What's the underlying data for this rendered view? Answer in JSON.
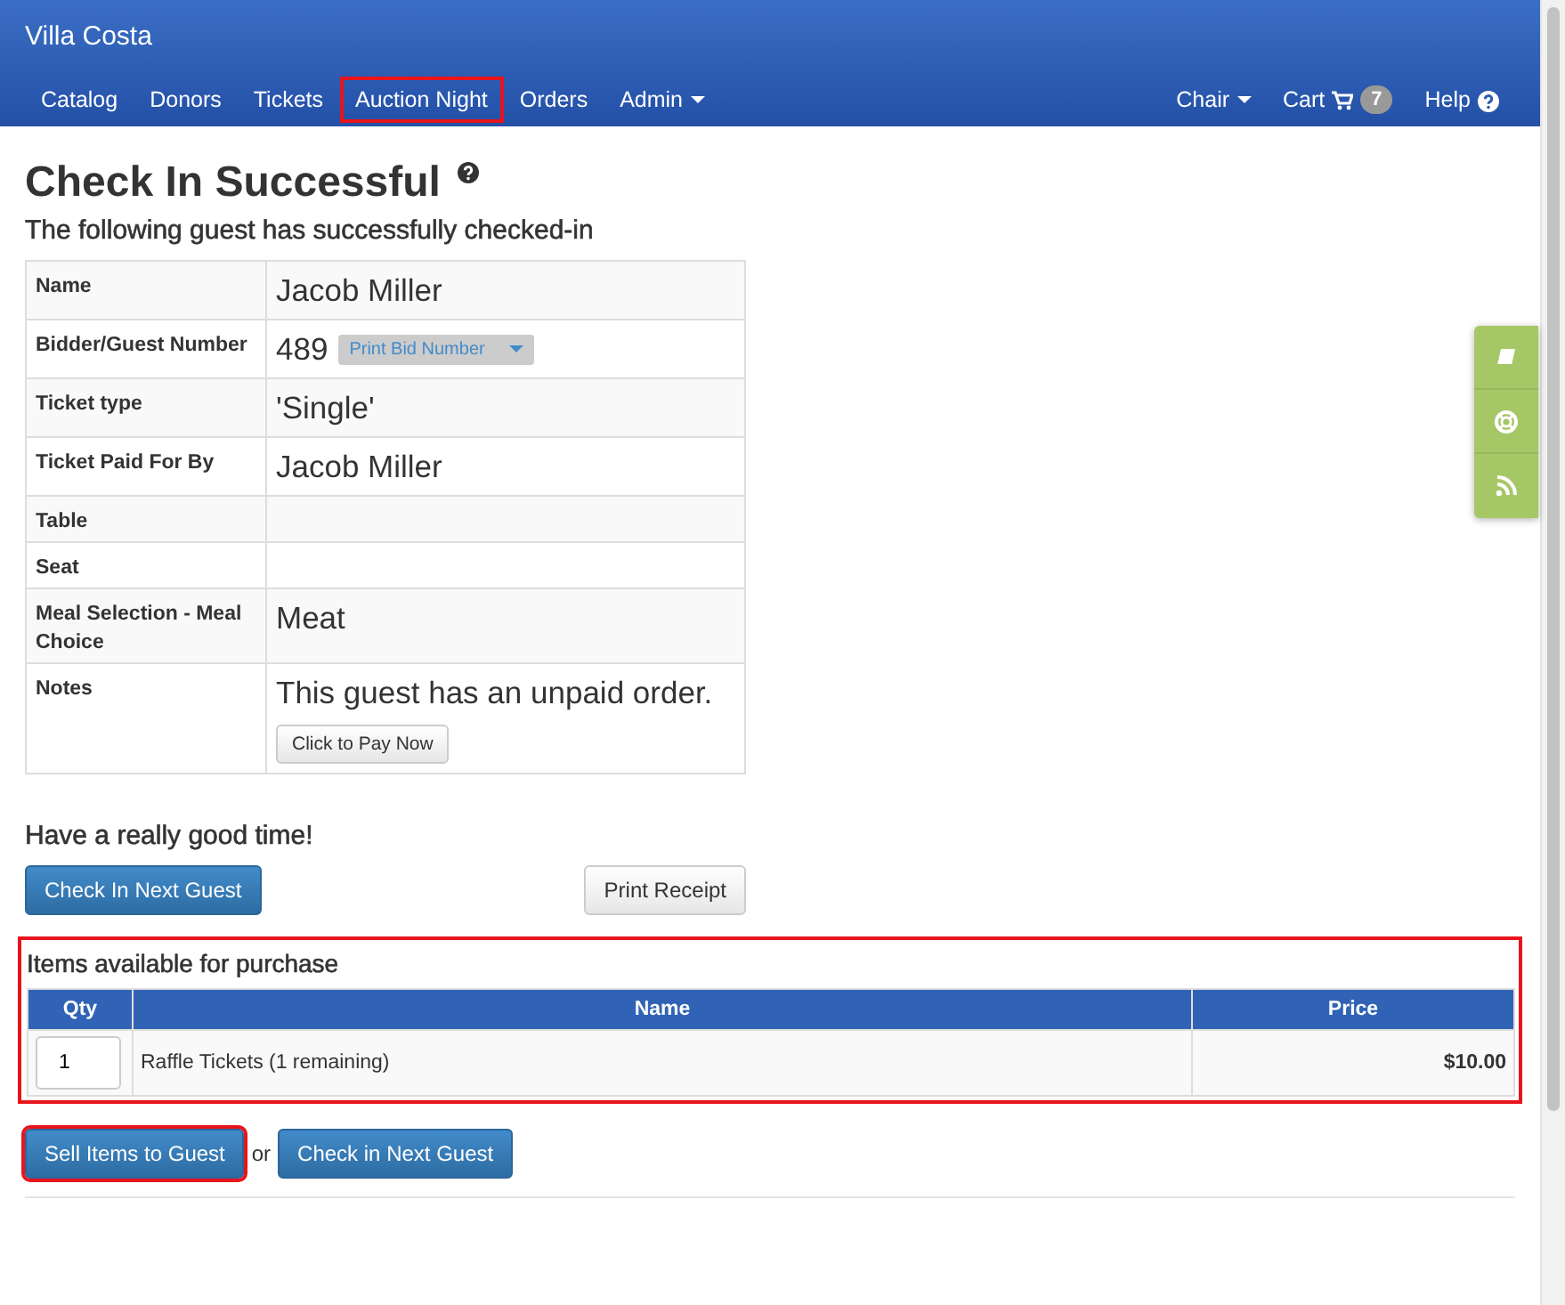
{
  "navbar": {
    "brand": "Villa Costa",
    "left_items": [
      {
        "label": "Catalog",
        "dropdown": false,
        "highlighted": false
      },
      {
        "label": "Donors",
        "dropdown": false,
        "highlighted": false
      },
      {
        "label": "Tickets",
        "dropdown": false,
        "highlighted": false
      },
      {
        "label": "Auction Night",
        "dropdown": false,
        "highlighted": true
      },
      {
        "label": "Orders",
        "dropdown": false,
        "highlighted": false
      },
      {
        "label": "Admin",
        "dropdown": true,
        "highlighted": false
      }
    ],
    "right_items": [
      {
        "label": "Chair",
        "kind": "dropdown"
      },
      {
        "label": "Cart",
        "kind": "cart",
        "badge": "7"
      },
      {
        "label": "Help",
        "kind": "help"
      }
    ]
  },
  "heading": "Check In Successful",
  "subheading": "The following guest has successfully checked-in",
  "guest_details": [
    {
      "label": "Name",
      "value": "Jacob Miller"
    },
    {
      "label": "Bidder/Guest Number",
      "value": "489",
      "button": "Print Bid Number"
    },
    {
      "label": "Ticket type",
      "value": "'Single'"
    },
    {
      "label": "Ticket Paid For By",
      "value": "Jacob Miller"
    },
    {
      "label": "Table"
    },
    {
      "label": "Seat"
    },
    {
      "label": "Meal Selection - Meal Choice",
      "value": "Meat"
    },
    {
      "label": "Notes",
      "value": "This guest has an unpaid order.",
      "button": "Click to Pay Now"
    }
  ],
  "farewell": "Have a really good time!",
  "actions": {
    "primary": "Check In Next Guest",
    "secondary": "Print Receipt"
  },
  "purchase": {
    "title": "Items available for purchase",
    "highlighted": true,
    "columns": [
      "Qty",
      "Name",
      "Price"
    ],
    "rows": [
      {
        "qty": "1",
        "name": "Raffle Tickets (1 remaining)",
        "price": "$10.00"
      }
    ]
  },
  "footer_actions": {
    "sell": {
      "label": "Sell Items to Guest",
      "highlighted": true
    },
    "separator": "or",
    "next": "Check in Next Guest"
  }
}
